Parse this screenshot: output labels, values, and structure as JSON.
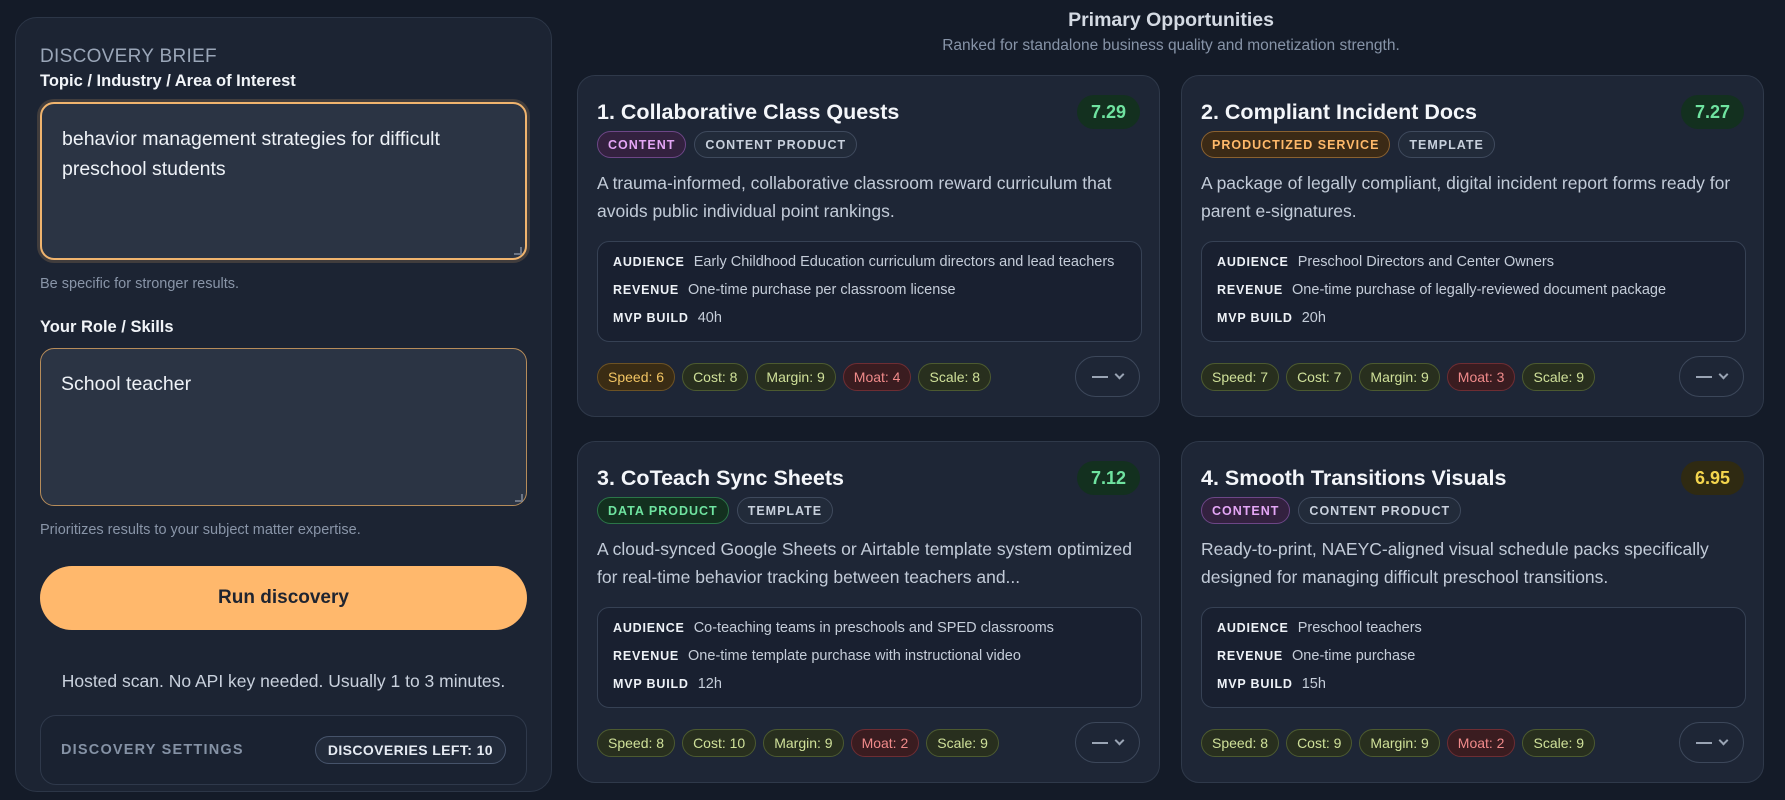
{
  "brief": {
    "title": "DISCOVERY BRIEF",
    "topic_label": "Topic / Industry / Area of Interest",
    "topic_value": "behavior management strategies for difficult preschool students",
    "topic_hint": "Be specific for stronger results.",
    "role_label": "Your Role / Skills",
    "role_value": "School teacher",
    "role_hint": "Prioritizes results to your subject matter expertise.",
    "run_label": "Run discovery",
    "hosted_note": "Hosted scan. No API key needed. Usually 1 to 3 minutes.",
    "settings_label": "DISCOVERY SETTINGS",
    "discoveries_left": "DISCOVERIES LEFT: 10"
  },
  "header": {
    "title": "Primary Opportunities",
    "subtitle": "Ranked for standalone business quality and monetization strength."
  },
  "meta_labels": {
    "audience": "AUDIENCE",
    "revenue": "REVENUE",
    "mvp": "MVP BUILD"
  },
  "cards": [
    {
      "title": "1. Collaborative Class Quests",
      "score": "7.29",
      "tag1": "CONTENT",
      "tag2": "CONTENT PRODUCT",
      "description": "A trauma-informed, collaborative classroom reward curriculum that avoids public individual point rankings.",
      "audience": "Early Childhood Education curriculum directors and lead teachers",
      "revenue": "One-time purchase per classroom license",
      "mvp": "40h",
      "metrics": {
        "speed": "Speed: 6",
        "cost": "Cost: 8",
        "margin": "Margin: 9",
        "moat": "Moat: 4",
        "scale": "Scale: 8"
      }
    },
    {
      "title": "2. Compliant Incident Docs",
      "score": "7.27",
      "tag1": "PRODUCTIZED SERVICE",
      "tag2": "TEMPLATE",
      "description": "A package of legally compliant, digital incident report forms ready for parent e-signatures.",
      "audience": "Preschool Directors and Center Owners",
      "revenue": "One-time purchase of legally-reviewed document package",
      "mvp": "20h",
      "metrics": {
        "speed": "Speed: 7",
        "cost": "Cost: 7",
        "margin": "Margin: 9",
        "moat": "Moat: 3",
        "scale": "Scale: 9"
      }
    },
    {
      "title": "3. CoTeach Sync Sheets",
      "score": "7.12",
      "tag1": "DATA PRODUCT",
      "tag2": "TEMPLATE",
      "description": "A cloud-synced Google Sheets or Airtable template system optimized for real-time behavior tracking between teachers and...",
      "audience": "Co-teaching teams in preschools and SPED classrooms",
      "revenue": "One-time template purchase with instructional video",
      "mvp": "12h",
      "metrics": {
        "speed": "Speed: 8",
        "cost": "Cost: 10",
        "margin": "Margin: 9",
        "moat": "Moat: 2",
        "scale": "Scale: 9"
      }
    },
    {
      "title": "4. Smooth Transitions Visuals",
      "score": "6.95",
      "tag1": "CONTENT",
      "tag2": "CONTENT PRODUCT",
      "description": "Ready-to-print, NAEYC-aligned visual schedule packs specifically designed for managing difficult preschool transitions.",
      "audience": "Preschool teachers",
      "revenue": "One-time purchase",
      "mvp": "15h",
      "metrics": {
        "speed": "Speed: 8",
        "cost": "Cost: 9",
        "margin": "Margin: 9",
        "moat": "Moat: 2",
        "scale": "Scale: 9"
      }
    }
  ]
}
